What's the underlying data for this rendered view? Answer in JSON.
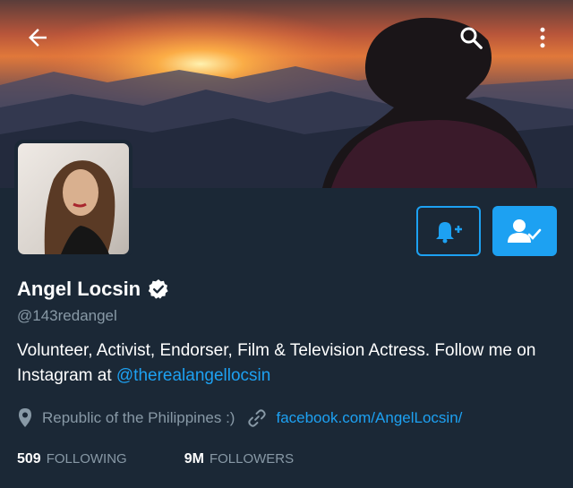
{
  "header": {
    "back_icon": "arrow-left-icon",
    "search_icon": "search-icon",
    "more_icon": "more-vertical-icon"
  },
  "profile": {
    "name": "Angel Locsin",
    "verified_icon": "verified-badge-icon",
    "handle": "@143redangel",
    "bio_text": "Volunteer, Activist, Endorser, Film & Television Actress. Follow me on Instagram at ",
    "bio_mention": "@therealangellocsin",
    "location": "Republic of the Philippines :)",
    "url": "facebook.com/AngelLocsin/"
  },
  "actions": {
    "notify_icon": "bell-plus-icon",
    "following_icon": "user-check-icon"
  },
  "stats": {
    "following_count": "509",
    "following_label": "FOLLOWING",
    "followers_count": "9M",
    "followers_label": "FOLLOWERS"
  },
  "colors": {
    "background": "#1b2836",
    "accent": "#1da1f2",
    "muted": "#8899a6"
  }
}
